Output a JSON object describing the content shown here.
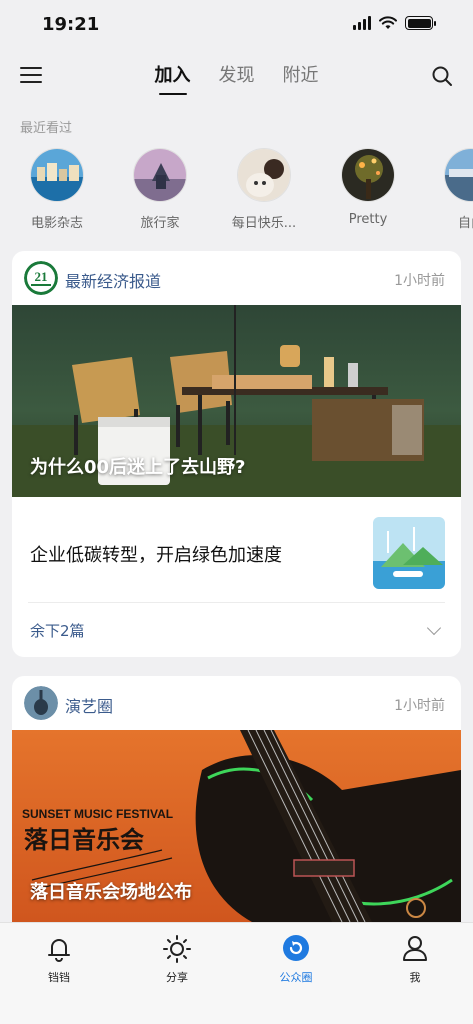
{
  "status_bar": {
    "time": "19:21"
  },
  "nav": {
    "tabs": [
      {
        "label": "加入"
      },
      {
        "label": "发现"
      },
      {
        "label": "附近"
      }
    ]
  },
  "recent": {
    "title": "最近看过",
    "items": [
      {
        "label": "电影杂志"
      },
      {
        "label": "旅行家"
      },
      {
        "label": "每日快乐..."
      },
      {
        "label": "Pretty"
      },
      {
        "label": "自由"
      }
    ]
  },
  "cards": [
    {
      "source": "最新经济报道",
      "logo_text": "21",
      "time": "1小时前",
      "hero_caption": "为什么00后迷上了去山野?",
      "article_title": "企业低碳转型，开启绿色加速度",
      "more_text": "余下2篇"
    },
    {
      "source": "演艺圈",
      "time": "1小时前",
      "poster_en": "SUNSET MUSIC FESTIVAL",
      "poster_cn": "落日音乐会",
      "hero_caption": "落日音乐会场地公布"
    }
  ],
  "bottom_bar": {
    "items": [
      {
        "label": "铛铛",
        "icon": "bell-icon"
      },
      {
        "label": "分享",
        "icon": "sun-icon"
      },
      {
        "label": "公众圈",
        "icon": "circle-refresh-icon"
      },
      {
        "label": "我",
        "icon": "user-icon"
      }
    ]
  },
  "colors": {
    "accent": "#1f7ae0",
    "source_blue": "#3b5b8c"
  }
}
